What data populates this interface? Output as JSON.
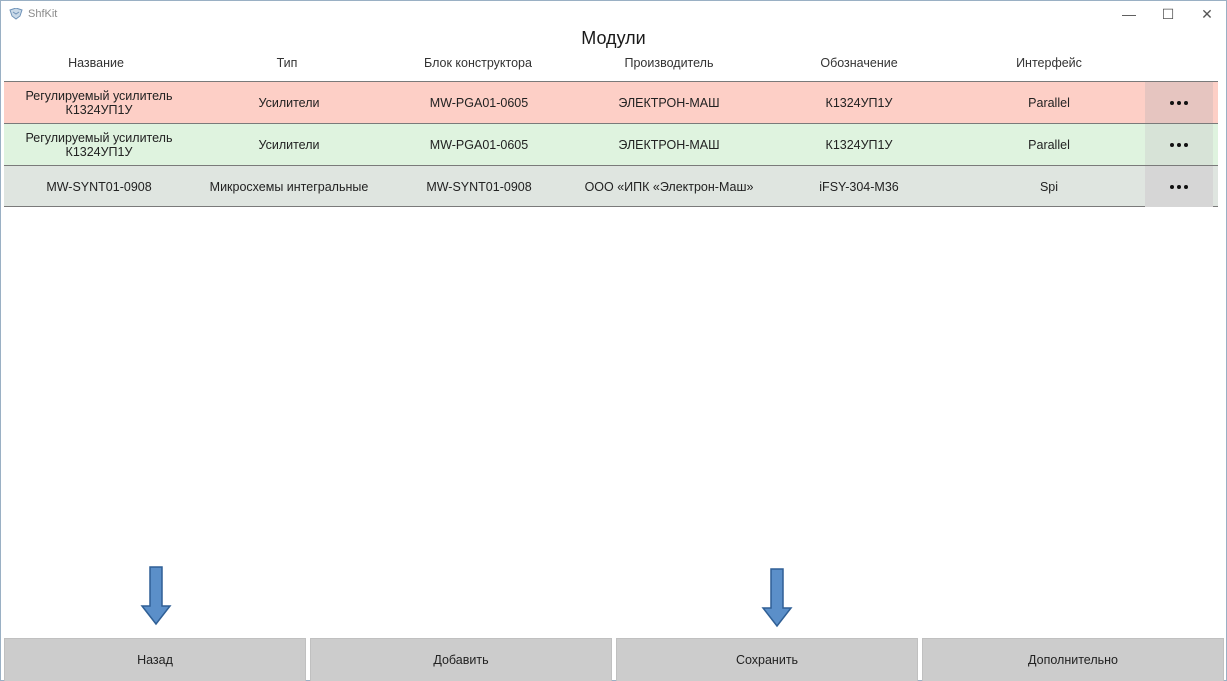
{
  "window": {
    "app_title": "ShfKit",
    "minimize_glyph": "—",
    "maximize_glyph": "☐",
    "close_glyph": "✕"
  },
  "page": {
    "title": "Модули"
  },
  "table": {
    "columns": [
      "Название",
      "Тип",
      "Блок конструктора",
      "Производитель",
      "Обозначение",
      "Интерфейс"
    ],
    "rows": [
      {
        "name": "Регулируемый усилитель К1324УП1У",
        "type": "Усилители",
        "block": "MW-PGA01-0605",
        "manufacturer": "ЭЛЕКТРОН-МАШ",
        "designation": "К1324УП1У",
        "interface": "Parallel",
        "color": "#fdcfc6",
        "more_color": "#e6c5c0"
      },
      {
        "name": "Регулируемый усилитель К1324УП1У",
        "type": "Усилители",
        "block": "MW-PGA01-0605",
        "manufacturer": "ЭЛЕКТРОН-МАШ",
        "designation": "К1324УП1У",
        "interface": "Parallel",
        "color": "#dff3df",
        "more_color": "#d7e3d7"
      },
      {
        "name": "MW-SYNT01-0908",
        "type": "Микросхемы интегральные",
        "block": "MW-SYNT01-0908",
        "manufacturer": "ООО «ИПК «Электрон-Маш»",
        "designation": "iFSY-304-M36",
        "interface": "Spi",
        "color": "#dfe5e0",
        "more_color": "#d6d6d6"
      }
    ]
  },
  "buttons": {
    "back": "Назад",
    "add": "Добавить",
    "save": "Сохранить",
    "more": "Дополнительно"
  },
  "colors": {
    "button_bg": "#cccccc",
    "arrow_fill": "#5b8fc9",
    "arrow_stroke": "#2f5f95"
  },
  "icons": {
    "app": "shfkit-logo-icon",
    "row_action": "more-dots-icon",
    "annotation": "down-arrow-icon"
  }
}
